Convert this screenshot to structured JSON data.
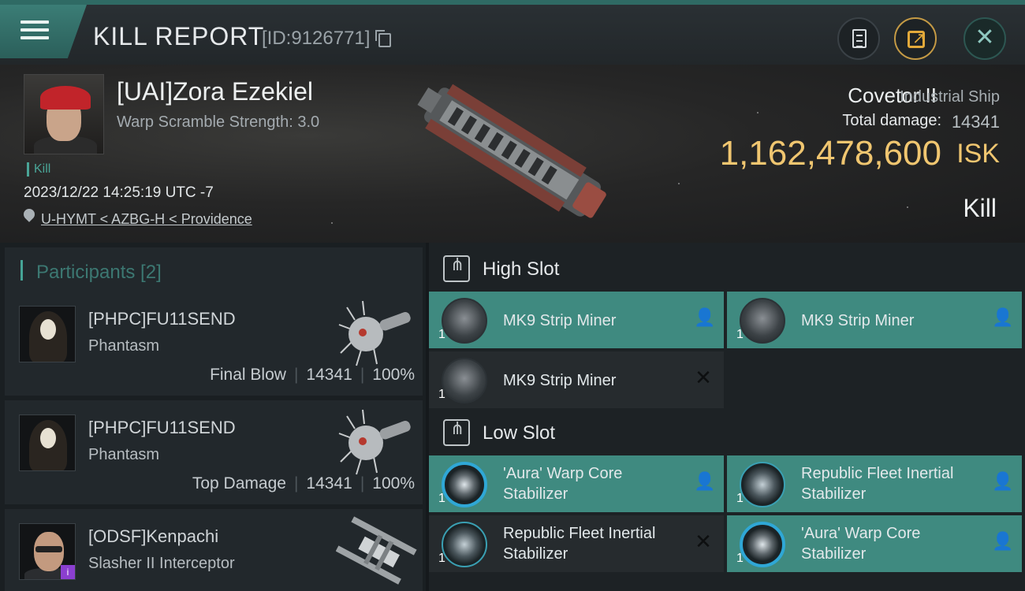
{
  "header": {
    "title": "KILL REPORT",
    "report_id": "[ID:9126771]"
  },
  "victim": {
    "name": "[UAI]Zora Ezekiel",
    "warp_scramble": "Warp Scramble Strength: 3.0",
    "tag": "Kill",
    "timestamp": "2023/12/22 14:25:19 UTC -7",
    "location": "U-HYMT < AZBG-H < Providence",
    "ship_name": "Covetor II",
    "ship_class": "Industrial Ship",
    "total_damage_label": "Total damage:",
    "total_damage": "14341",
    "isk_value": "1,162,478,600",
    "isk_unit": "ISK",
    "result": "Kill"
  },
  "participants": {
    "heading": "Participants [2]",
    "rows": [
      {
        "name": "[PHPC]FU11SEND",
        "ship": "Phantasm",
        "role": "Final Blow",
        "damage": "14341",
        "percent": "100%"
      },
      {
        "name": "[PHPC]FU11SEND",
        "ship": "Phantasm",
        "role": "Top Damage",
        "damage": "14341",
        "percent": "100%"
      },
      {
        "name": "[ODSF]Kenpachi",
        "ship": "Slasher II Interceptor",
        "badge": "i"
      }
    ]
  },
  "fitting": {
    "high_slot": {
      "title": "High Slot",
      "modules": [
        {
          "qty": "1",
          "name": "MK9 Strip Miner",
          "state": "fitted"
        },
        {
          "qty": "1",
          "name": "MK9 Strip Miner",
          "state": "fitted"
        },
        {
          "qty": "1",
          "name": "MK9 Strip Miner",
          "state": "destroyed"
        }
      ]
    },
    "low_slot": {
      "title": "Low Slot",
      "modules": [
        {
          "qty": "1",
          "line1": "'Aura' Warp Core",
          "line2": "Stabilizer",
          "state": "fitted"
        },
        {
          "qty": "1",
          "line1": "Republic Fleet Inertial",
          "line2": "Stabilizer",
          "state": "fitted"
        },
        {
          "qty": "1",
          "line1": "Republic Fleet Inertial",
          "line2": "Stabilizer",
          "state": "destroyed"
        },
        {
          "qty": "1",
          "line1": "'Aura' Warp Core",
          "line2": "Stabilizer",
          "state": "fitted"
        }
      ]
    }
  },
  "colors": {
    "accent": "#3f8a80",
    "isk": "#f0c670",
    "share_ring": "#c49a45"
  },
  "icons": {
    "menu": "hamburger-icon",
    "copy": "copy-icon",
    "clipboard": "clipboard-icon",
    "share": "share-icon",
    "close": "close-icon",
    "location": "location-pin-icon",
    "slot": "slot-icon",
    "fitted": "person-icon",
    "destroyed": "x-icon"
  }
}
